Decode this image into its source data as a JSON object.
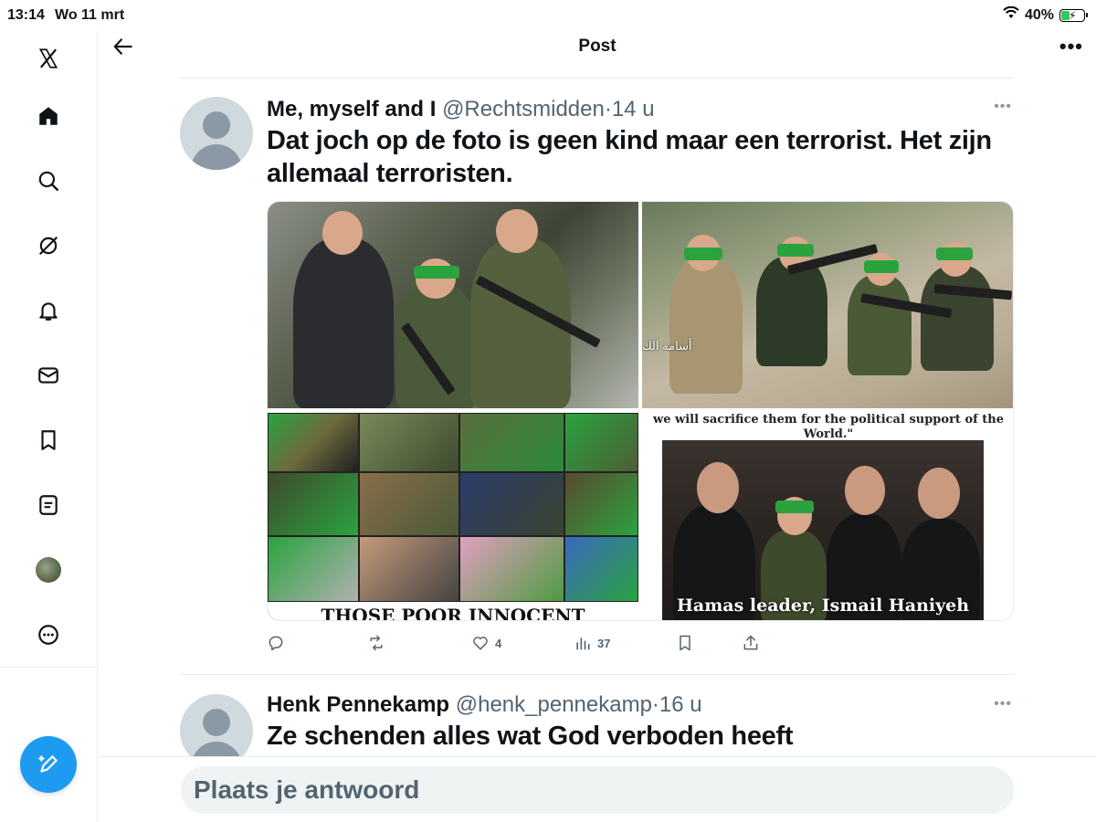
{
  "status_bar": {
    "time": "13:14",
    "date": "Wo 11 mrt",
    "battery": "40%",
    "battery_level": 0.4
  },
  "sidebar": {
    "items": [
      {
        "name": "x-logo-icon"
      },
      {
        "name": "home-icon"
      },
      {
        "name": "search-icon"
      },
      {
        "name": "grok-icon"
      },
      {
        "name": "notifications-bell-icon"
      },
      {
        "name": "messages-icon"
      },
      {
        "name": "bookmarks-icon"
      },
      {
        "name": "lists-icon"
      },
      {
        "name": "profile-avatar"
      },
      {
        "name": "more-icon"
      }
    ],
    "compose_icon": "compose-feather-icon"
  },
  "header": {
    "title": "Post",
    "back_icon": "arrow-left-icon",
    "more_icon": "more-horizontal-icon"
  },
  "main_post": {
    "author_name": "Me, myself and I",
    "handle_and_time": "@Rechtsmidden·14 u",
    "text": "Dat joch op de foto is geen kind maar een terrorist. Het zijn allemaal terroristen.",
    "media": {
      "tile3_caption": "THOSE POOR INNOCENT",
      "tile4_caption_top": "we will sacrifice them for the political support of the World.\"",
      "tile4_caption_bottom": "Hamas leader, Ismail Haniyeh",
      "tile2_overlay": "أسامة الك"
    },
    "actions": {
      "replies": "",
      "reposts": "",
      "likes": "4",
      "views": "37"
    }
  },
  "reply_post": {
    "author_name": "Henk Pennekamp",
    "handle_and_time": "@henk_pennekamp·16 u",
    "text": "Ze schenden alles wat God verboden heeft"
  },
  "reply_bar": {
    "placeholder": "Plaats je antwoord"
  },
  "colors": {
    "accent": "#1d9bf0",
    "text": "#0f1419",
    "secondary": "#536471",
    "border": "#e6ecf0"
  }
}
